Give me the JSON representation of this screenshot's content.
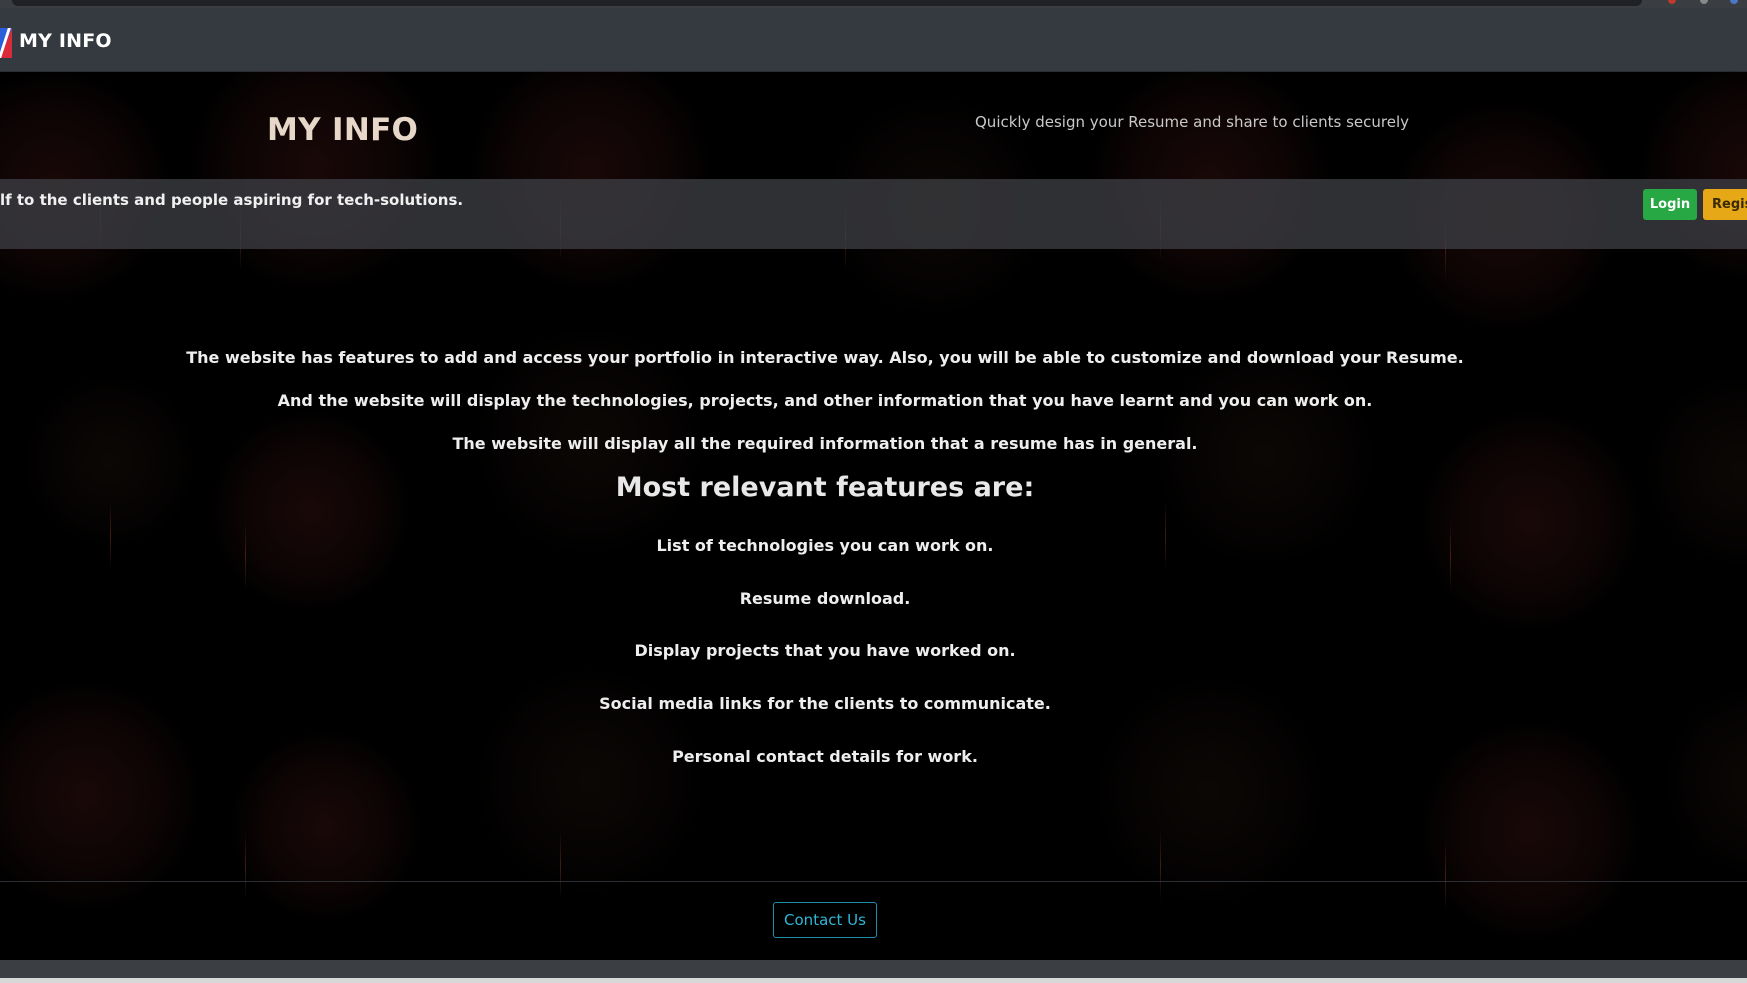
{
  "navbar": {
    "brand": "MY INFO"
  },
  "hero": {
    "title": "MY INFO",
    "tagline": "Quickly design your Resume and share to clients securely"
  },
  "info_band": {
    "ticker": "lf to the clients and people aspiring for tech-solutions.",
    "login_label": "Login",
    "register_label": "Regis"
  },
  "main": {
    "paragraphs": [
      "The website has features to add and access your portfolio in interactive way. Also, you will be able to customize and download your Resume.",
      "And the website will display the technologies, projects, and other information that you have learnt and you can work on.",
      "The website will display all the required information that a resume has in general."
    ],
    "features_heading": "Most relevant features are:",
    "features": [
      "List of technologies you can work on.",
      "Resume download.",
      "Display projects that you have worked on.",
      "Social media links for the clients to communicate.",
      "Personal contact details for work."
    ]
  },
  "footer": {
    "contact_label": "Contact Us"
  },
  "colors": {
    "navbar_bg": "#343a40",
    "login_green": "#28a745",
    "register_yellow": "#e6a817",
    "contact_cyan": "#2fb7d6"
  }
}
